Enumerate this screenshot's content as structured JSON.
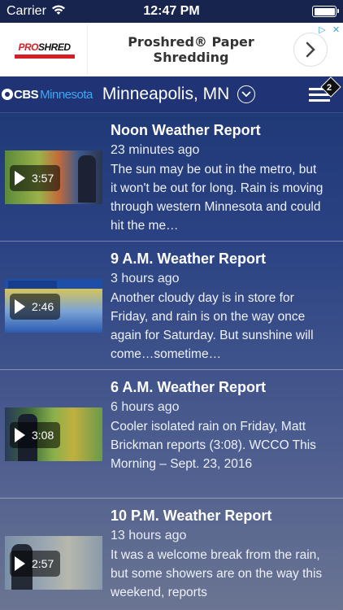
{
  "status_bar": {
    "carrier": "Carrier",
    "time": "12:47 PM",
    "battery_level": 1.0
  },
  "ad": {
    "logo_text_red": "PRO",
    "logo_text_black": "SHRED",
    "title": "Proshred® Paper Shredding",
    "arrow_icon": "chevron-right-icon",
    "choices_icon": "adchoices-icon"
  },
  "header": {
    "brand_cbs": "CBS",
    "brand_region": "Minnesota",
    "location": "Minneapolis, MN",
    "menu_badge": "2"
  },
  "reports": [
    {
      "title": "Noon Weather Report",
      "time": "23 minutes ago",
      "description": "The sun may be out in the metro, but it won't be out for long. Rain is moving through western Minnesota and could hit the me…",
      "duration": "3:57"
    },
    {
      "title": "9 A.M. Weather Report",
      "time": "3 hours ago",
      "description": "Another cloudy day is in store for Friday, and rain is on the way once again for Saturday. But sunshine will come…sometime…",
      "duration": "2:46"
    },
    {
      "title": "6 A.M. Weather Report",
      "time": "6 hours ago",
      "description": "Cooler isolated rain on Friday, Matt Brickman reports (3:08). WCCO This Morning – Sept. 23, 2016",
      "duration": "3:08"
    },
    {
      "title": "10 P.M. Weather Report",
      "time": "13 hours ago",
      "description": "It was a welcome break from the rain, but some showers are on the way this weekend, reports",
      "duration": "2:57"
    }
  ],
  "colors": {
    "header_bg": "#1f3375",
    "status_bg": "#16244e",
    "brand_blue": "#3fa9f5",
    "ad_red": "#d51f26"
  }
}
